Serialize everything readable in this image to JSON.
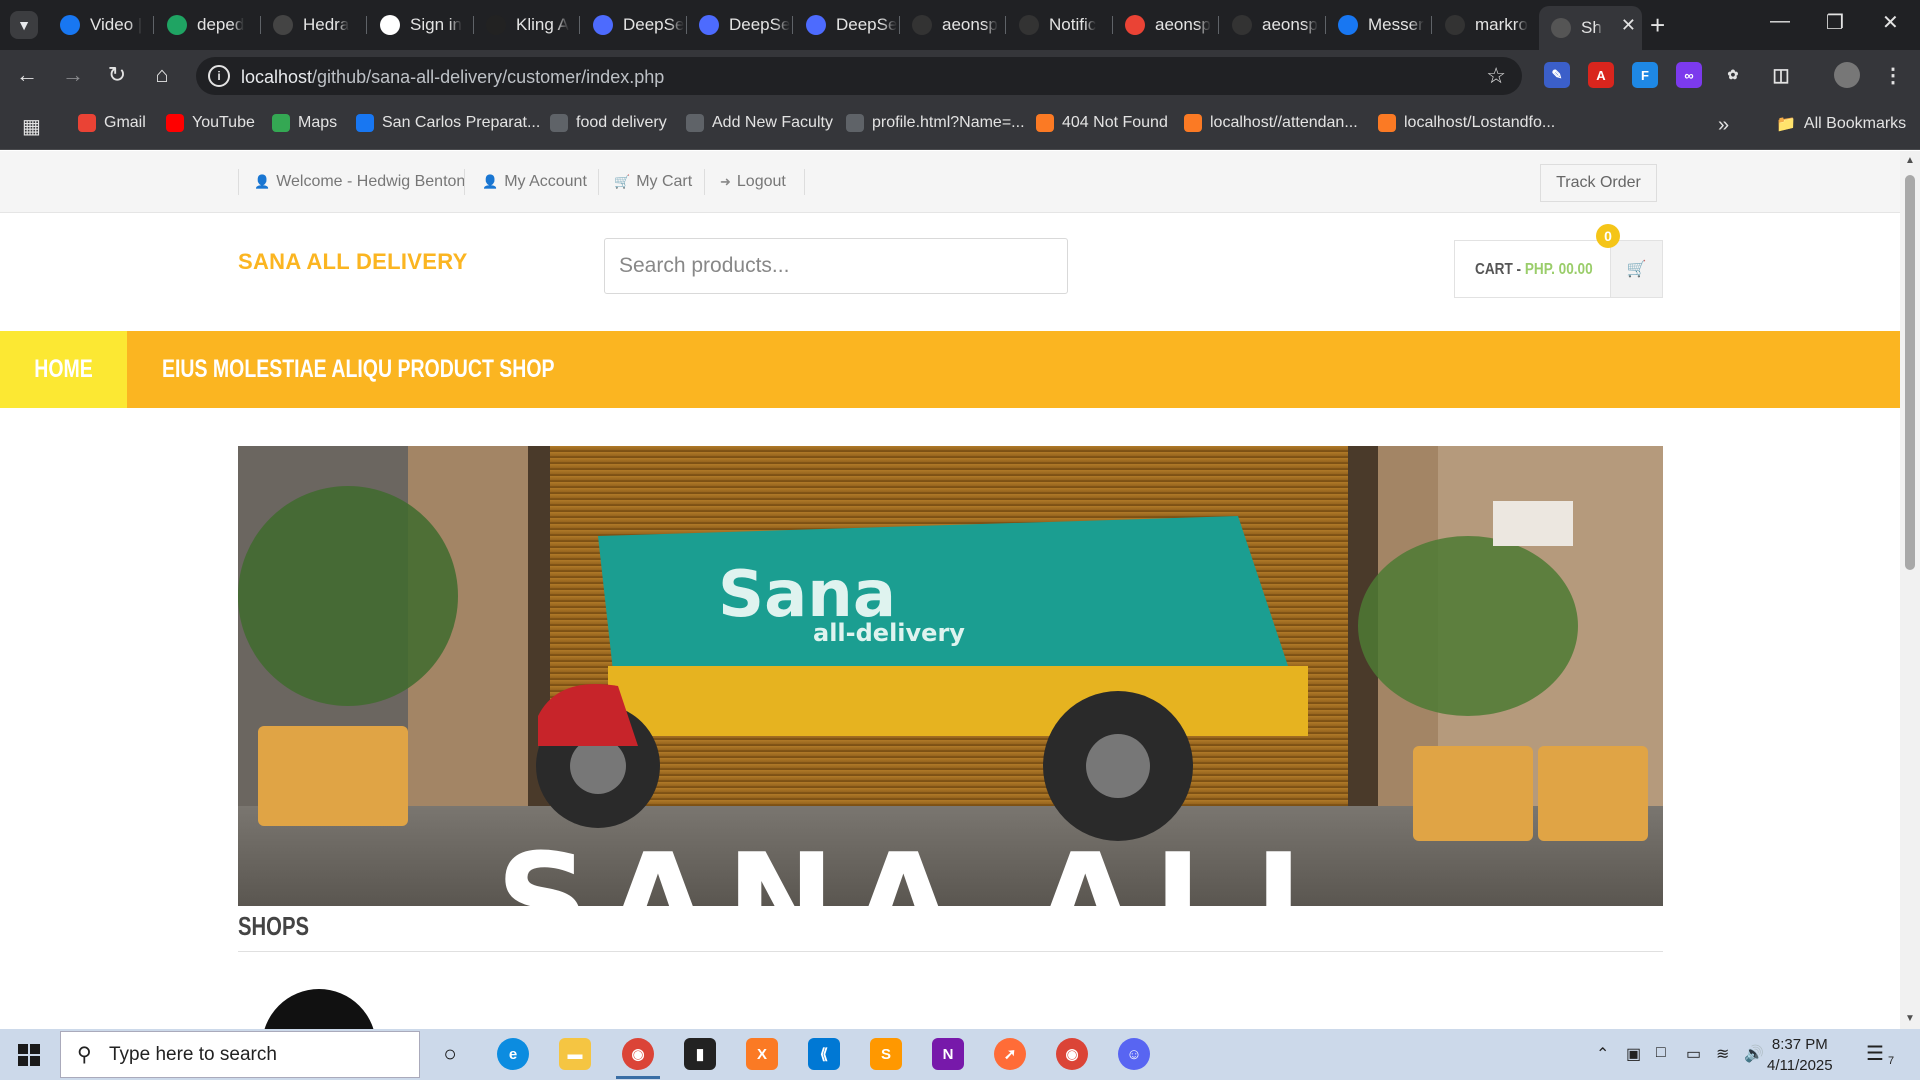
{
  "browser": {
    "tabs": [
      {
        "label": "Video |",
        "icon": "facebook-icon",
        "color": "#1877f2"
      },
      {
        "label": "deped",
        "icon": "google-drive-icon",
        "color": "#1fa463"
      },
      {
        "label": "Hedra",
        "icon": "hedra-icon",
        "color": "#444"
      },
      {
        "label": "Sign in",
        "icon": "google-icon",
        "color": "#ffffff"
      },
      {
        "label": "Kling A",
        "icon": "kling-icon",
        "color": "#222"
      },
      {
        "label": "DeepSe",
        "icon": "deepseek-icon",
        "color": "#4d6bfe"
      },
      {
        "label": "DeepSe",
        "icon": "deepseek-icon",
        "color": "#4d6bfe"
      },
      {
        "label": "DeepSe",
        "icon": "deepseek-icon",
        "color": "#4d6bfe"
      },
      {
        "label": "aeonsp",
        "icon": "github-icon",
        "color": "#333"
      },
      {
        "label": "Notific",
        "icon": "github-icon",
        "color": "#333"
      },
      {
        "label": "aeonsp",
        "icon": "gmail-icon",
        "color": "#ea4335"
      },
      {
        "label": "aeonsp",
        "icon": "github-icon",
        "color": "#333"
      },
      {
        "label": "Messer",
        "icon": "facebook-icon",
        "color": "#1877f2"
      },
      {
        "label": "markro",
        "icon": "github-icon",
        "color": "#333"
      },
      {
        "label": "Sh",
        "icon": "page-icon",
        "color": "#555"
      }
    ],
    "url_host": "localhost",
    "url_path": "/github/sana-all-delivery/customer/index.php",
    "bookmarks": [
      {
        "label": "Gmail",
        "icon": "gmail-icon",
        "color": "#ea4335"
      },
      {
        "label": "YouTube",
        "icon": "youtube-icon",
        "color": "#ff0000"
      },
      {
        "label": "Maps",
        "icon": "maps-icon",
        "color": "#34a853"
      },
      {
        "label": "San Carlos Preparat...",
        "icon": "facebook-icon",
        "color": "#1877f2"
      },
      {
        "label": "food delivery",
        "icon": "globe-icon",
        "color": "#5f6368"
      },
      {
        "label": "Add New Faculty",
        "icon": "globe-icon",
        "color": "#5f6368"
      },
      {
        "label": "profile.html?Name=...",
        "icon": "globe-icon",
        "color": "#5f6368"
      },
      {
        "label": "404 Not Found",
        "icon": "xampp-icon",
        "color": "#fb7a24"
      },
      {
        "label": "localhost//attendan...",
        "icon": "xampp-icon",
        "color": "#fb7a24"
      },
      {
        "label": "localhost/Lostandfo...",
        "icon": "xampp-icon",
        "color": "#fb7a24"
      }
    ],
    "all_bookmarks": "All Bookmarks"
  },
  "page": {
    "topbar": {
      "welcome": "Welcome - Hedwig Benton",
      "my_account": "My Account",
      "my_cart": "My Cart",
      "logout": "Logout",
      "track_order": "Track Order"
    },
    "logo": "SANA ALL DELIVERY",
    "search_placeholder": "Search products...",
    "cart": {
      "label": "CART - ",
      "amount": "PHP. 00.00",
      "count": "0"
    },
    "nav": {
      "home": "HOME",
      "shop": "EIUS MOLESTIAE ALIQU PRODUCT SHOP"
    },
    "banner": {
      "brand": "Sana",
      "sub": "all-delivery",
      "big_text": "SANA ALL"
    },
    "shops_title": "SHOPS"
  },
  "taskbar": {
    "search_placeholder": "Type here to search",
    "time": "8:37 PM",
    "date": "4/11/2025",
    "notifications": "7"
  },
  "colors": {
    "accent": "#fbb521",
    "home": "#fce833",
    "cart_amount": "#9acd6a"
  }
}
